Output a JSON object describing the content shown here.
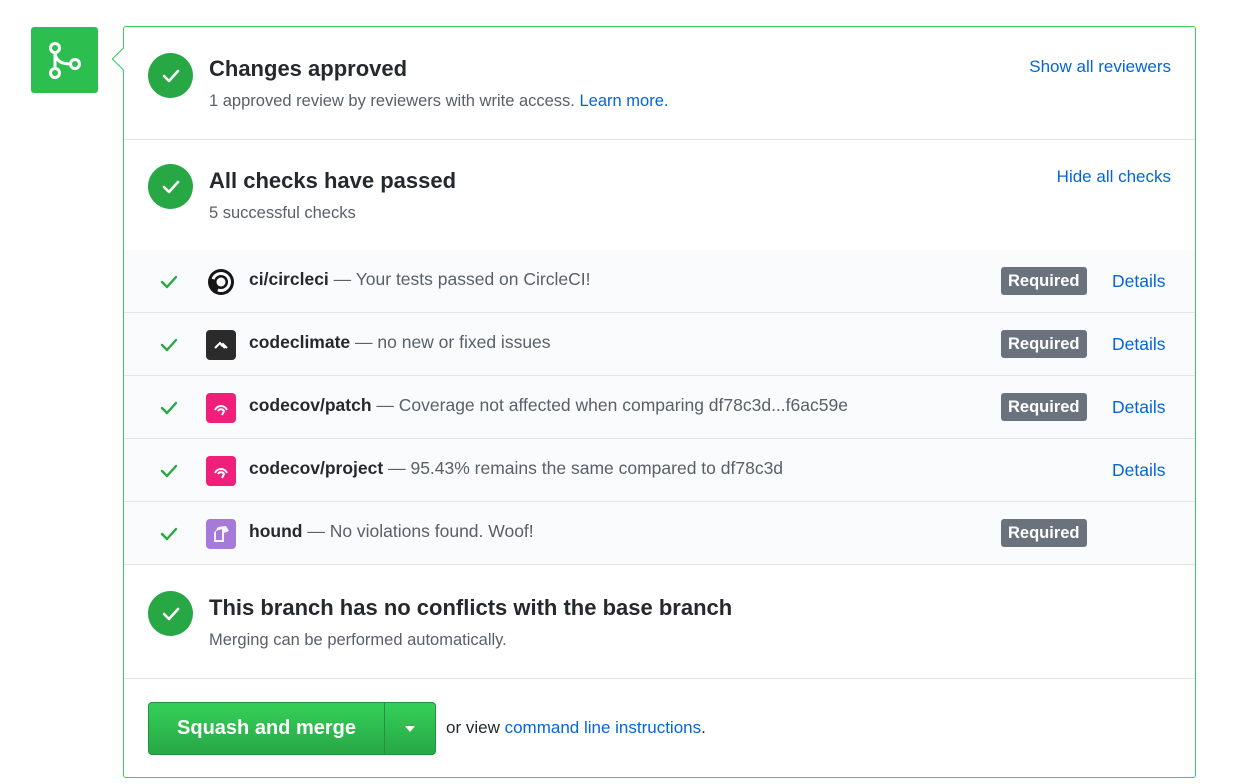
{
  "approval": {
    "title": "Changes approved",
    "subtitle": "1 approved review by reviewers with write access.",
    "learn_more": "Learn more.",
    "show_reviewers": "Show all reviewers"
  },
  "checks_summary": {
    "title": "All checks have passed",
    "subtitle": "5 successful checks",
    "hide_checks": "Hide all checks"
  },
  "checks": [
    {
      "name": "ci/circleci",
      "description": "— Your tests passed on CircleCI!",
      "required": "Required",
      "details": "Details",
      "icon": "circleci-icon",
      "color": "#161616"
    },
    {
      "name": "codeclimate",
      "description": "— no new or fixed issues",
      "required": "Required",
      "details": "Details",
      "icon": "codeclimate-icon",
      "color": "#2b2b2b"
    },
    {
      "name": "codecov/patch",
      "description": "— Coverage not affected when comparing df78c3d...f6ac59e",
      "required": "Required",
      "details": "Details",
      "icon": "codecov-icon",
      "color": "#f01f7a"
    },
    {
      "name": "codecov/project",
      "description": "— 95.43% remains the same compared to df78c3d",
      "required": "",
      "details": "Details",
      "icon": "codecov-icon",
      "color": "#f01f7a"
    },
    {
      "name": "hound",
      "description": "— No violations found. Woof!",
      "required": "Required",
      "details": "",
      "icon": "hound-icon",
      "color": "#a57ad8"
    }
  ],
  "conflicts": {
    "title": "This branch has no conflicts with the base branch",
    "subtitle": "Merging can be performed automatically."
  },
  "merge": {
    "button_label": "Squash and merge",
    "alt_prefix": "or view",
    "alt_link": "command line instructions",
    "alt_suffix": "."
  },
  "colors": {
    "success": "#28a745",
    "link": "#0366d6",
    "badge": "#6a737d"
  }
}
